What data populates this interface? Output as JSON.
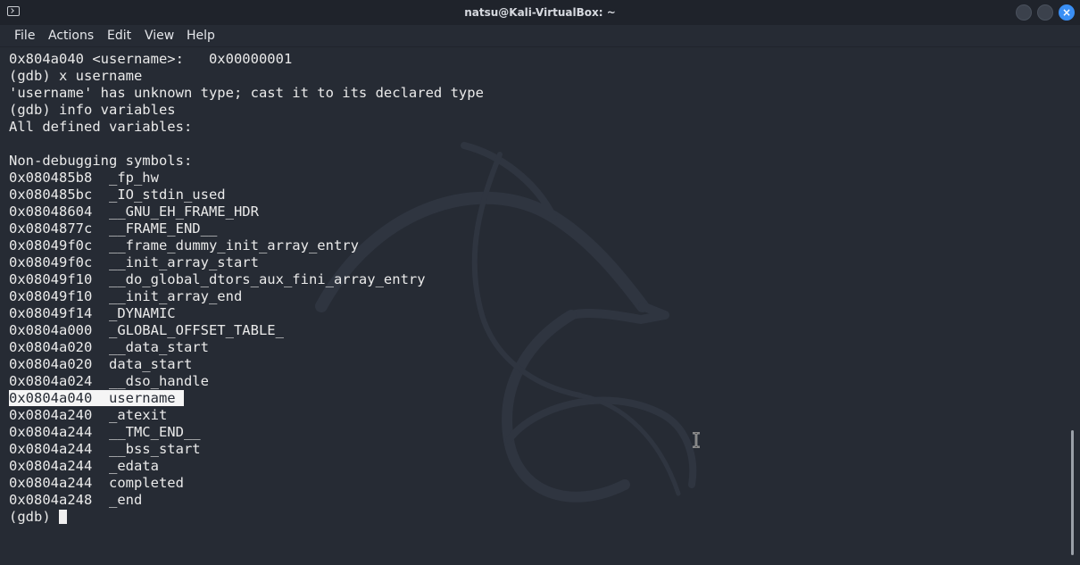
{
  "window": {
    "title": "natsu@Kali-VirtualBox: ~",
    "close_glyph": "×"
  },
  "menu": {
    "items": [
      "File",
      "Actions",
      "Edit",
      "View",
      "Help"
    ]
  },
  "terminal": {
    "lines": [
      "0x804a040 <username>:   0x00000001",
      "(gdb) x username",
      "'username' has unknown type; cast it to its declared type",
      "(gdb) info variables",
      "All defined variables:",
      "",
      "Non-debugging symbols:",
      "0x080485b8  _fp_hw",
      "0x080485bc  _IO_stdin_used",
      "0x08048604  __GNU_EH_FRAME_HDR",
      "0x0804877c  __FRAME_END__",
      "0x08049f0c  __frame_dummy_init_array_entry",
      "0x08049f0c  __init_array_start",
      "0x08049f10  __do_global_dtors_aux_fini_array_entry",
      "0x08049f10  __init_array_end",
      "0x08049f14  _DYNAMIC",
      "0x0804a000  _GLOBAL_OFFSET_TABLE_",
      "0x0804a020  __data_start",
      "0x0804a020  data_start",
      "0x0804a024  __dso_handle",
      "0x0804a040  username ",
      "0x0804a240  _atexit",
      "0x0804a244  __TMC_END__",
      "0x0804a244  __bss_start",
      "0x0804a244  _edata",
      "0x0804a244  completed",
      "0x0804a248  _end"
    ],
    "selected_line": 20,
    "prompt": "(gdb) "
  },
  "icons": {
    "app": "terminal-icon",
    "minimize": "minimize-icon",
    "maximize": "maximize-icon",
    "close": "close-icon",
    "pointer": "text-cursor-ibeam-icon",
    "wallpaper": "kali-dragon-logo"
  },
  "colors": {
    "terminal_bg": "#262b34",
    "text": "#eaeaea",
    "selection_bg": "#f5f5f5",
    "close_button": "#3a8ff5"
  }
}
